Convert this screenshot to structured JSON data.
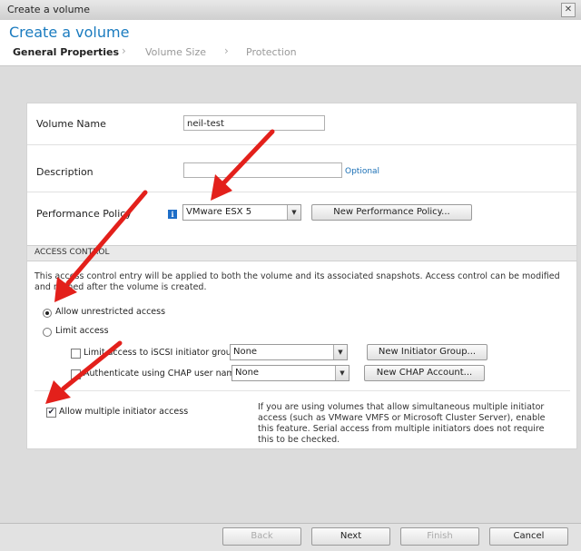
{
  "window": {
    "title": "Create a volume"
  },
  "header": {
    "title": "Create a volume",
    "steps": [
      "General Properties",
      "Volume Size",
      "Protection"
    ]
  },
  "form": {
    "volume_name": {
      "label": "Volume Name",
      "value": "neil-test"
    },
    "description": {
      "label": "Description",
      "value": "",
      "hint": "Optional"
    },
    "performance_policy": {
      "label": "Performance Policy",
      "value": "VMware ESX 5",
      "new_button": "New Performance Policy..."
    }
  },
  "access_control": {
    "header": "ACCESS CONTROL",
    "description": "This access control entry will be applied to both the volume and its associated snapshots. Access control can be modified and refined after the volume is created.",
    "unrestricted_label": "Allow unrestricted access",
    "limit_label": "Limit access",
    "iscsi": {
      "label": "Limit access to iSCSI initiator group",
      "value": "None",
      "button": "New Initiator Group..."
    },
    "chap": {
      "label": "Authenticate using CHAP user name",
      "value": "None",
      "button": "New CHAP Account..."
    },
    "multi_initiator_label": "Allow multiple initiator access",
    "multi_initiator_help": "If you are using volumes that allow simultaneous multiple initiator access (such as VMware VMFS or Microsoft Cluster Server), enable this feature. Serial access from multiple initiators does not require this to be checked."
  },
  "footer": {
    "back": "Back",
    "next": "Next",
    "finish": "Finish",
    "cancel": "Cancel"
  },
  "colors": {
    "accent": "#1a7bbf",
    "annotation_arrow": "#e3201b"
  }
}
